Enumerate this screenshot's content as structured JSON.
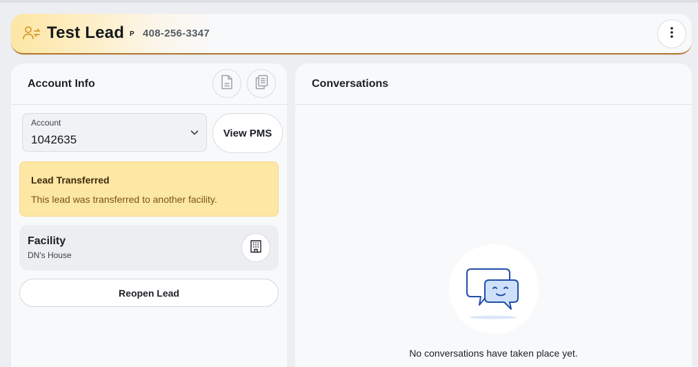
{
  "header": {
    "title": "Test Lead",
    "badge": "P",
    "phone": "408-256-3347",
    "icon": "user-transfer-icon",
    "menu_icon": "more-vertical-icon",
    "accent_color": "#b5752a"
  },
  "account_info": {
    "title": "Account Info",
    "toolbar_icons": [
      "document-icon",
      "clipboard-icon"
    ],
    "account_select": {
      "label": "Account",
      "value": "1042635"
    },
    "view_pms_label": "View PMS",
    "alert": {
      "title": "Lead Transferred",
      "message": "This lead was transferred to another facility.",
      "color": "#fde7a4"
    },
    "facility": {
      "title": "Facility",
      "name": "DN's House",
      "icon": "building-icon"
    },
    "reopen_label": "Reopen Lead"
  },
  "conversations": {
    "title": "Conversations",
    "empty_icon": "chat-bubbles-icon",
    "empty_message": "No conversations have taken place yet."
  }
}
